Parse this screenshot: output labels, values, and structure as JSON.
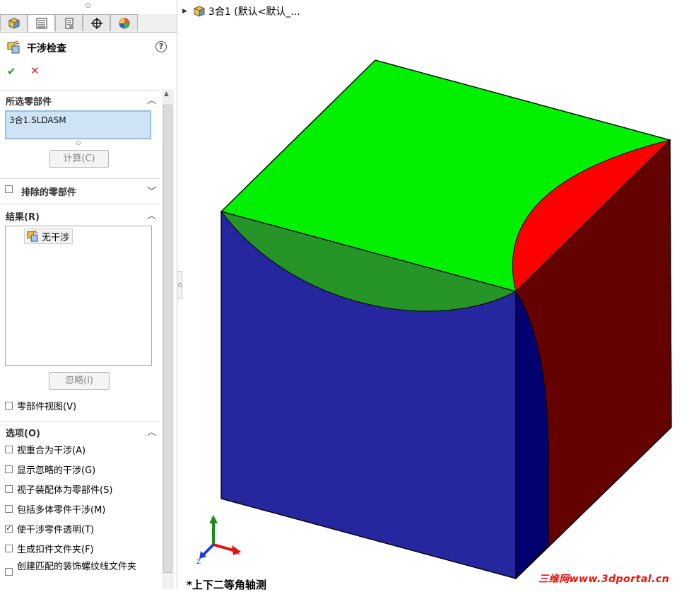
{
  "panel": {
    "tabs": [
      "feature-manager-icon",
      "property-manager-icon",
      "configuration-manager-icon",
      "dimxpert-icon",
      "display-manager-icon"
    ],
    "title": "干涉检查",
    "help": "?",
    "ok": "✔",
    "cancel": "✕",
    "selected": {
      "header": "所选零部件",
      "value": "3合1.SLDASM",
      "calc_button": "计算(C)"
    },
    "excluded": {
      "header": "排除的零部件"
    },
    "results": {
      "header": "结果(R)",
      "items": [
        "无干涉"
      ],
      "ignore_button": "忽略(I)"
    },
    "component_view": "零部件视图(V)",
    "options": {
      "header": "选项(O)",
      "items": [
        {
          "label": "视重合为干涉(A)",
          "checked": false
        },
        {
          "label": "显示忽略的干涉(G)",
          "checked": false
        },
        {
          "label": "视子装配体为零部件(S)",
          "checked": false
        },
        {
          "label": "包括多体零件干涉(M)",
          "checked": false
        },
        {
          "label": "使干涉零件透明(T)",
          "checked": true
        },
        {
          "label": "生成扣件文件夹(F)",
          "checked": false
        },
        {
          "label": "创建匹配的装饰螺纹线文件夹",
          "checked": false
        }
      ]
    }
  },
  "viewport": {
    "tree_label": "3合1  (默认<默认_...",
    "view_name": "*上下二等角轴测",
    "watermark": "三维网www.3dportal.cn",
    "axes": {
      "x": "X",
      "y": "Y",
      "z": "Z"
    },
    "colors": {
      "top": "#00f000",
      "top_overlap": "#279427",
      "front": "#26269e",
      "front_inner": "#020170",
      "right": "#640101",
      "right_red": "#ff0000"
    }
  }
}
